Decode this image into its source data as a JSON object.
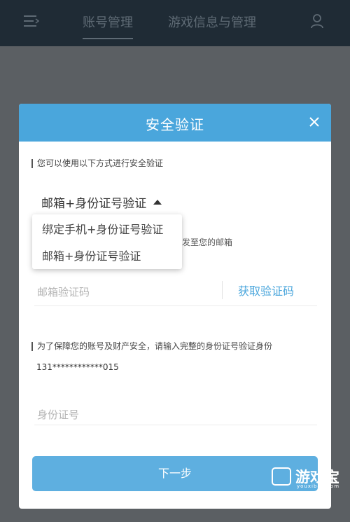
{
  "topbar": {
    "menu_icon": "menu-icon",
    "tabs": [
      {
        "label": "账号管理",
        "active": true
      },
      {
        "label": "游戏信息与管理",
        "active": false
      }
    ],
    "user_icon": "user-icon"
  },
  "modal": {
    "title": "安全验证",
    "close_icon": "close-icon",
    "method_hint": "您可以使用以下方式进行安全验证",
    "selected_method": "邮箱+身份证号验证",
    "method_options": [
      "绑定手机+身份证号验证",
      "邮箱+身份证号验证"
    ],
    "send_hint_partial": "发至您的邮箱",
    "email_code_placeholder": "邮箱验证码",
    "get_code_label": "获取验证码",
    "id_hint": "为了保障您的账号及财产安全，请输入完整的身份证号验证身份",
    "masked_id": "131************015",
    "id_placeholder": "身份证号",
    "next_label": "下一步"
  },
  "watermark": {
    "brand": "游戏宝",
    "url": "youxibao.com"
  },
  "colors": {
    "header_blue": "#4aa6dc",
    "button_blue": "#5eafe0",
    "topbar_bg": "#1f2b35",
    "overlay": "#5b5f63"
  }
}
